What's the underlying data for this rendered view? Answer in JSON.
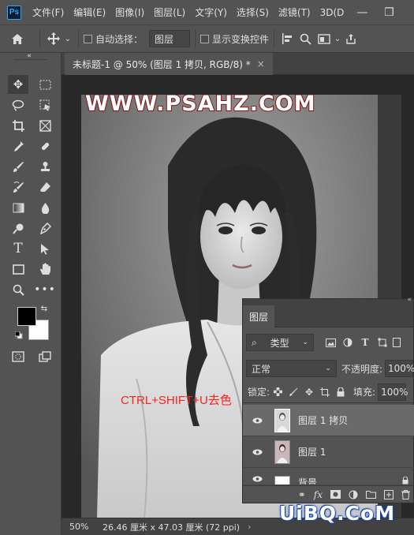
{
  "app": {
    "logo": "Ps"
  },
  "menu": [
    "文件(F)",
    "编辑(E)",
    "图像(I)",
    "图层(L)",
    "文字(Y)",
    "选择(S)",
    "滤镜(T)",
    "3D(D"
  ],
  "window_controls": {
    "minimize": "—",
    "restore": "❐"
  },
  "options_bar": {
    "auto_select_label": "自动选择：",
    "auto_select_target": "图层",
    "show_transform_label": "显示变换控件"
  },
  "document_tab": {
    "title": "未标题-1 @ 50% (图层 1 拷贝, RGB/8) *",
    "close": "×"
  },
  "status_bar": {
    "zoom": "50%",
    "doc_info": "26.46 厘米 x 47.03 厘米 (72 ppi)"
  },
  "canvas": {
    "watermark": "WWW.PSAHZ.COM",
    "caption": "CTRL+SHIFT+U去色"
  },
  "colors": {
    "foreground": "#000000",
    "background": "#ffffff",
    "caption": "#ff2020",
    "watermark_stroke": "#8b1010"
  },
  "layers_panel": {
    "title": "图层",
    "filter_kind": "类型",
    "blend_mode": "正常",
    "opacity_label": "不透明度:",
    "opacity_value": "100%",
    "lock_label": "锁定:",
    "fill_label": "填充:",
    "fill_value": "100%",
    "layers": [
      {
        "name": "图层 1 拷贝",
        "selected": true
      },
      {
        "name": "图层 1",
        "selected": false
      },
      {
        "name": "背景",
        "selected": false
      }
    ]
  },
  "site_watermark": "UiBQ.CoM"
}
